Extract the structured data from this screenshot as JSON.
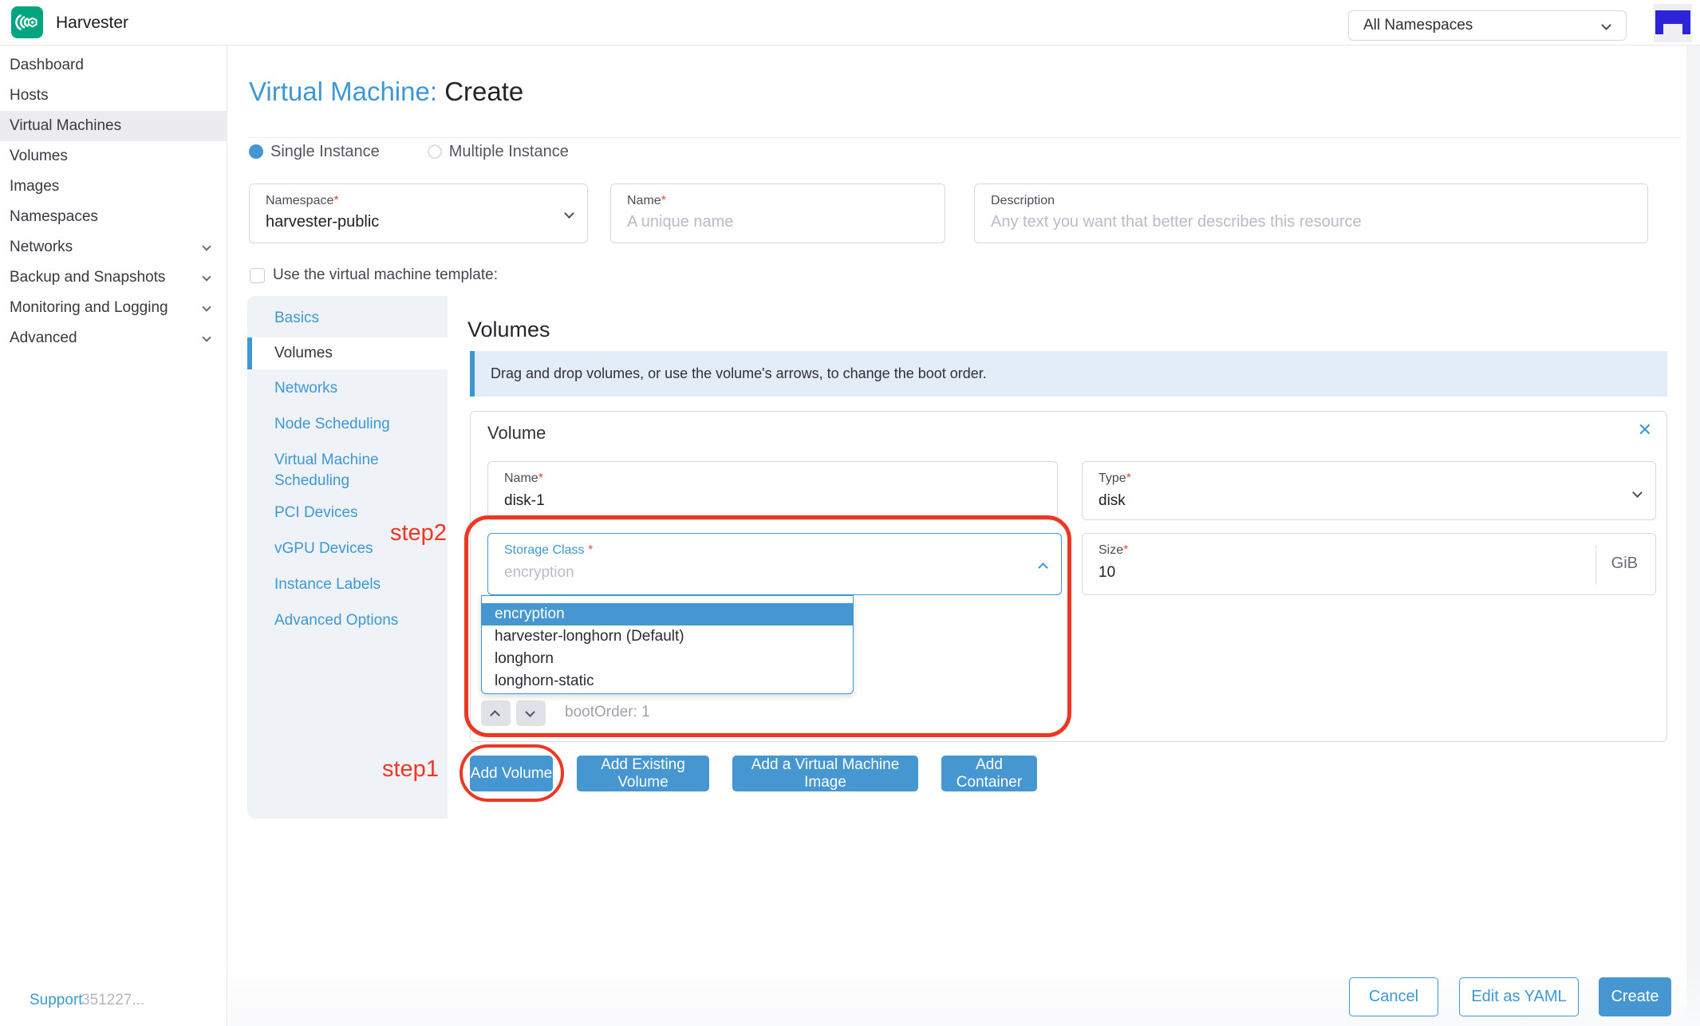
{
  "header": {
    "app_name": "Harvester",
    "namespace_filter": "All Namespaces"
  },
  "sidebar": {
    "items": [
      {
        "label": "Dashboard",
        "active": false,
        "expandable": false
      },
      {
        "label": "Hosts",
        "active": false,
        "expandable": false
      },
      {
        "label": "Virtual Machines",
        "active": true,
        "expandable": false
      },
      {
        "label": "Volumes",
        "active": false,
        "expandable": false
      },
      {
        "label": "Images",
        "active": false,
        "expandable": false
      },
      {
        "label": "Namespaces",
        "active": false,
        "expandable": false
      },
      {
        "label": "Networks",
        "active": false,
        "expandable": true
      },
      {
        "label": "Backup and Snapshots",
        "active": false,
        "expandable": true
      },
      {
        "label": "Monitoring and Logging",
        "active": false,
        "expandable": true
      },
      {
        "label": "Advanced",
        "active": false,
        "expandable": true
      }
    ],
    "support_label": "Support",
    "version_text": "351227..."
  },
  "page": {
    "title_prefix": "Virtual Machine:",
    "title_action": "Create",
    "required_mark": "*",
    "instance_single": "Single Instance",
    "instance_multiple": "Multiple Instance",
    "fields": {
      "namespace": {
        "label": "Namespace",
        "value": "harvester-public"
      },
      "name": {
        "label": "Name",
        "placeholder": "A unique name"
      },
      "description": {
        "label": "Description",
        "placeholder": "Any text you want that better describes this resource"
      }
    },
    "template_checkbox": "Use the virtual machine template:"
  },
  "tabs": [
    "Basics",
    "Volumes",
    "Networks",
    "Node Scheduling",
    "Virtual Machine Scheduling",
    "PCI Devices",
    "vGPU Devices",
    "Instance Labels",
    "Advanced Options"
  ],
  "volumes": {
    "heading": "Volumes",
    "banner": "Drag and drop volumes, or use the volume's arrows, to change the boot order.",
    "volume": {
      "title": "Volume",
      "close_glyph": "✕",
      "name_label": "Name",
      "name_value": "disk-1",
      "type_label": "Type",
      "type_value": "disk",
      "storage_label": "Storage Class",
      "storage_placeholder": "encryption",
      "size_label": "Size",
      "size_value": "10",
      "size_unit": "GiB",
      "boot_order": "bootOrder: 1",
      "options": [
        "encryption",
        "harvester-longhorn (Default)",
        "longhorn",
        "longhorn-static"
      ],
      "selected_option": "encryption"
    },
    "buttons": [
      "Add Volume",
      "Add Existing Volume",
      "Add a Virtual Machine Image",
      "Add Container"
    ]
  },
  "annotations": {
    "step1": "step1",
    "step2": "step2"
  },
  "footer": {
    "cancel": "Cancel",
    "edit_yaml": "Edit as YAML",
    "create": "Create"
  },
  "colors": {
    "accent_blue": "#3d98d3",
    "button_blue": "#4596d1",
    "annotation_red": "#ee3722",
    "logo_teal": "#00a57f",
    "avatar_blue": "#2c24d8",
    "banner_bg": "#e2edf8",
    "tab_panel_bg": "#eff2f7"
  }
}
